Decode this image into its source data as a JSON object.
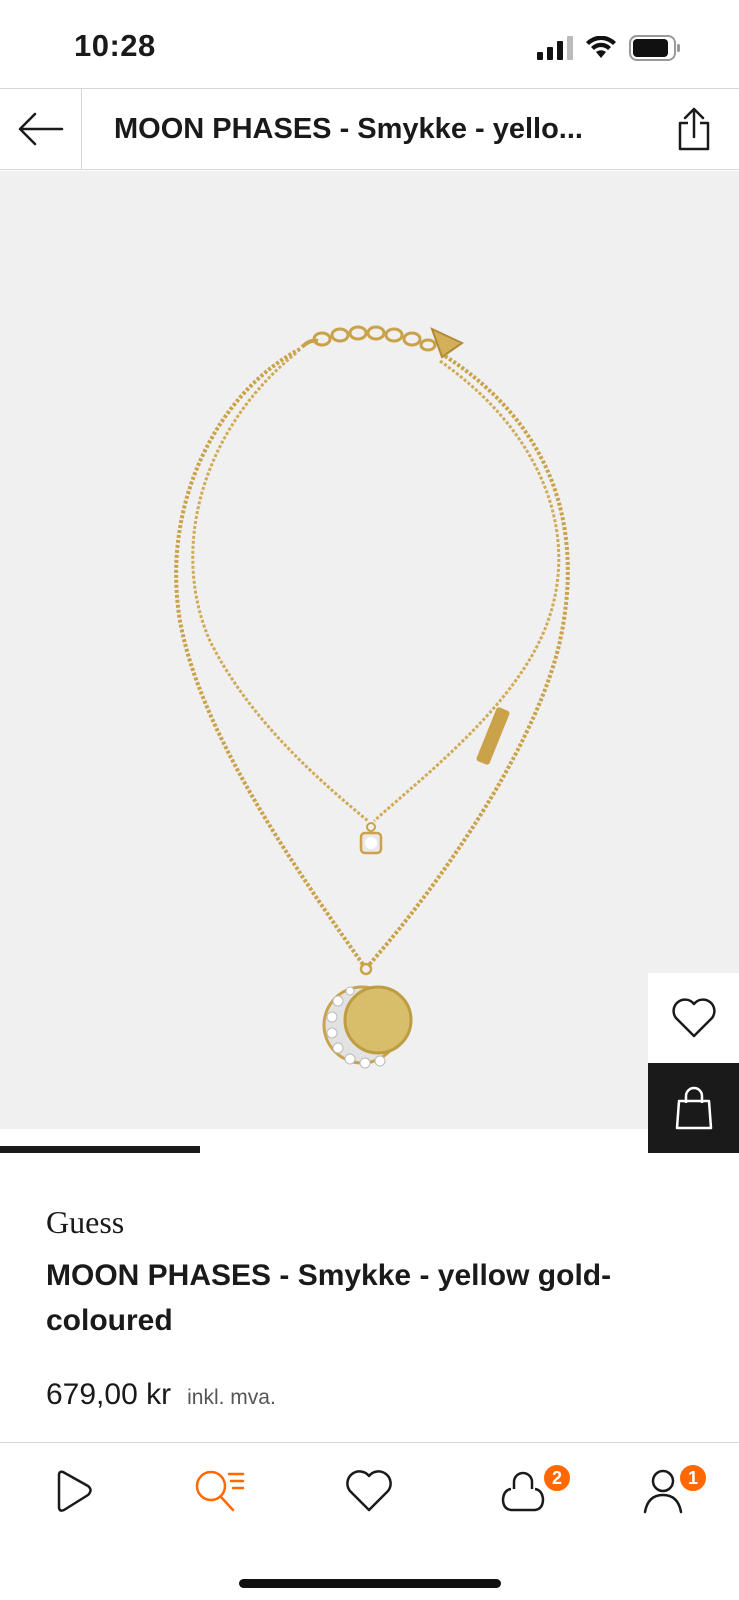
{
  "status_bar": {
    "time": "10:28"
  },
  "header": {
    "title": "MOON PHASES - Smykke - yello..."
  },
  "product": {
    "brand": "Guess",
    "name": "MOON PHASES - Smykke - yellow gold-coloured",
    "price": "679,00 kr",
    "vat_note": "inkl. mva."
  },
  "carousel": {
    "active_index": 1,
    "total": 3
  },
  "bottom_nav": {
    "bag_badge": "2",
    "account_badge": "1"
  },
  "colors": {
    "accent": "#ff6900",
    "text": "#1a1a1a",
    "image_bg": "#f0f0f0"
  },
  "icons": [
    "back-arrow-icon",
    "share-icon",
    "heart-icon",
    "shopping-bag-icon",
    "play-icon",
    "search-filter-icon",
    "account-icon"
  ]
}
